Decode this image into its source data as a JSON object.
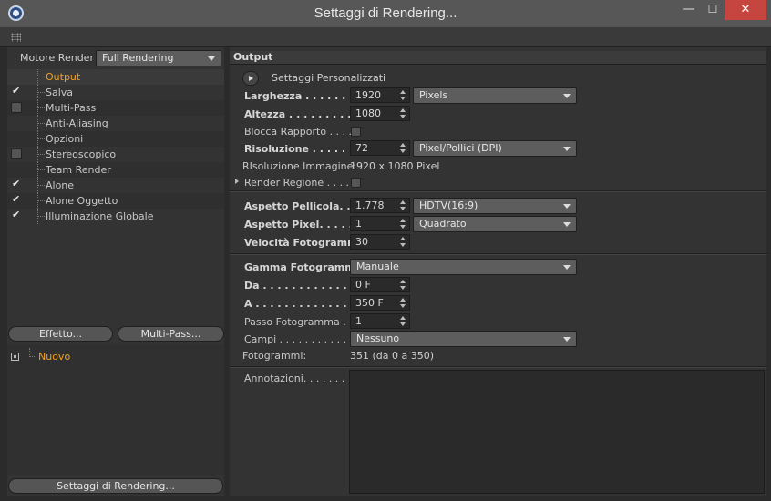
{
  "window": {
    "title": "Settaggi di Rendering...",
    "min": "—",
    "max": "☐",
    "close": "✕"
  },
  "left": {
    "engine_label": "Motore Render",
    "engine_value": "Full Rendering",
    "items": [
      {
        "label": "Output",
        "checked": null,
        "active": true
      },
      {
        "label": "Salva",
        "checked": true
      },
      {
        "label": "Multi-Pass",
        "checked": false
      },
      {
        "label": "Anti-Aliasing",
        "checked": null
      },
      {
        "label": "Opzioni",
        "checked": null
      },
      {
        "label": "Stereoscopico",
        "checked": false
      },
      {
        "label": "Team Render",
        "checked": null
      },
      {
        "label": "Alone",
        "checked": true
      },
      {
        "label": "Alone Oggetto",
        "checked": true
      },
      {
        "label": "Illuminazione Globale",
        "checked": true
      }
    ],
    "effect_button": "Effetto...",
    "multipass_button": "Multi-Pass...",
    "preset_label": "Nuovo",
    "settings_button": "Settaggi di Rendering..."
  },
  "right": {
    "section_title": "Output",
    "custom_settings": "Settaggi  Personalizzati",
    "width_label": "Larghezza . . . . . . . . .",
    "width_value": "1920",
    "width_unit": "Pixels",
    "height_label": "Altezza . . . . . . . . . . . .",
    "height_value": "1080",
    "lock_ratio_label": "Blocca Rapporto . . . .",
    "resolution_label": "Risoluzione . . . . . . . .",
    "resolution_value": "72",
    "resolution_unit": "Pixel/Pollici (DPI)",
    "image_res_label": "RIsoluzione Immagine:",
    "image_res_value": "1920 x 1080 Pixel",
    "region_label": "Render Regione . . . .",
    "film_aspect_label": "Aspetto Pellicola. . . .",
    "film_aspect_value": "1.778",
    "film_aspect_preset": "HDTV(16:9)",
    "pixel_aspect_label": "Aspetto Pixel. . . . . . .",
    "pixel_aspect_value": "1",
    "pixel_aspect_preset": "Quadrato",
    "frame_rate_label": "Velocità Fotogramma",
    "frame_rate_value": "30",
    "frame_range_label": "Gamma Fotogramma",
    "frame_range_value": "Manuale",
    "from_label": "Da . . . . . . . . . . . . . . . .",
    "from_value": "0 F",
    "to_label": "A . . . . . . . . . . . . . . . . .",
    "to_value": "350 F",
    "frame_step_label": "Passo Fotogramma . .",
    "frame_step_value": "1",
    "fields_label": "Campi . . . . . . . . . . . .",
    "fields_value": "Nessuno",
    "frames_label": "Fotogrammi:",
    "frames_value": "351 (da 0 a 350)",
    "notes_label": "Annotazioni. . . . . . . ."
  }
}
